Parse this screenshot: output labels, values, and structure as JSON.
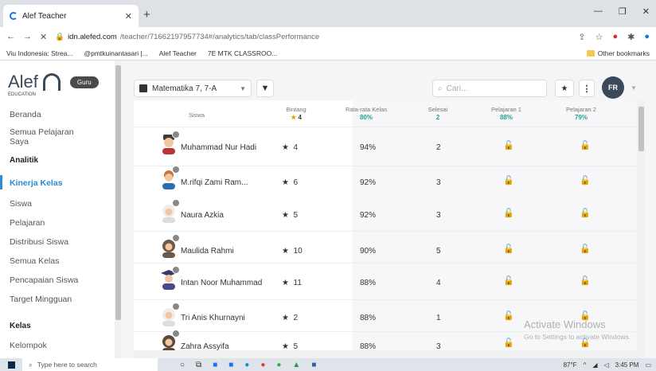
{
  "browser": {
    "tab_title": "Alef Teacher",
    "url_host": "idn.alefed.com",
    "url_path": "/teacher/71662197957734#/analytics/tab/classPerformance",
    "bookmarks": [
      "Viu Indonesia: Strea...",
      "@pmtkuinantasari |...",
      "Alef Teacher",
      "7E MTK CLASSROO..."
    ],
    "other_bookmarks": "Other bookmarks"
  },
  "sidebar": {
    "logo": "Alef",
    "logo_sub": "EDUCATION",
    "role": "Guru",
    "items": [
      {
        "label": "Beranda"
      },
      {
        "label": "Semua Pelajaran Saya"
      },
      {
        "label": "Analitik"
      },
      {
        "label": "Kinerja Kelas"
      },
      {
        "label": "Siswa"
      },
      {
        "label": "Pelajaran"
      },
      {
        "label": "Distribusi Siswa"
      },
      {
        "label": "Semua Kelas"
      },
      {
        "label": "Pencapaian Siswa"
      },
      {
        "label": "Target Mingguan"
      },
      {
        "label": "Kelas"
      },
      {
        "label": "Kelompok"
      }
    ]
  },
  "toolbar": {
    "class_select": "Matematika 7, 7-A",
    "search_placeholder": "Cari...",
    "avatar": "FR"
  },
  "table": {
    "headers": {
      "siswa": "Siswa",
      "bintang": "Bintang",
      "bintang_val": "4",
      "rata": "Rata-rata Kelas",
      "rata_val": "80%",
      "selesai": "Selesai",
      "selesai_val": "2",
      "p1": "Pelajaran 1",
      "p1_val": "88%",
      "p2": "Pelajaran 2",
      "p2_val": "79%"
    },
    "rows": [
      {
        "name": "Muhammad Nur Hadi",
        "stars": "4",
        "avg": "94%",
        "done": "2"
      },
      {
        "name": "M.rifqi Zami Ram...",
        "stars": "6",
        "avg": "92%",
        "done": "3"
      },
      {
        "name": "Naura Azkia",
        "stars": "5",
        "avg": "92%",
        "done": "3"
      },
      {
        "name": "Maulida Rahmi",
        "stars": "10",
        "avg": "90%",
        "done": "5"
      },
      {
        "name": "Intan Noor Muhammad",
        "stars": "11",
        "avg": "88%",
        "done": "4"
      },
      {
        "name": "Tri Anis Khurnayni",
        "stars": "2",
        "avg": "88%",
        "done": "1"
      },
      {
        "name": "Zahra Assyifa",
        "stars": "5",
        "avg": "88%",
        "done": "3"
      }
    ]
  },
  "watermark": {
    "title": "Activate Windows",
    "sub": "Go to Settings to activate Windows."
  },
  "taskbar": {
    "search": "Type here to search",
    "weather": "87°F",
    "time": "3:45 PM"
  },
  "colors": {
    "accent": "#2a8bd6",
    "teal": "#2a9d8f",
    "dark": "#3a4a5a"
  }
}
